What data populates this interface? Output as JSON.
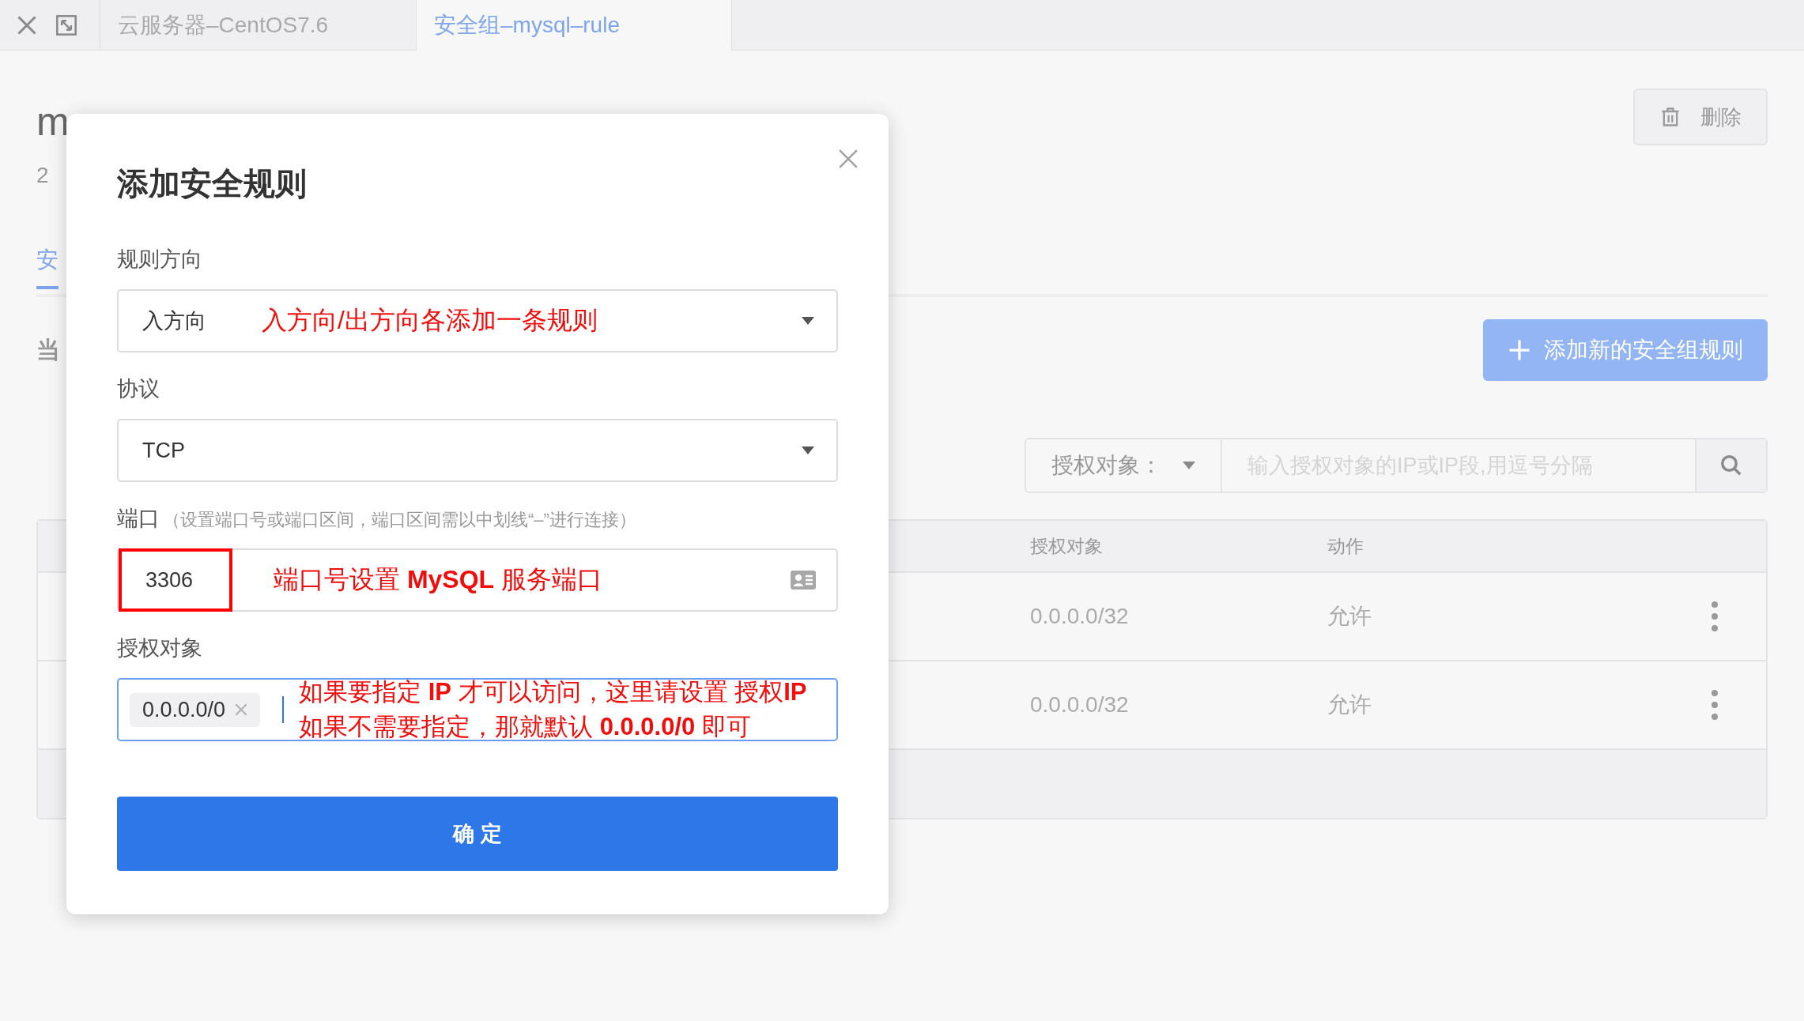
{
  "browser_tabs": [
    {
      "label": "云服务器–CentOS7.6",
      "selected": false
    },
    {
      "label": "安全组–mysql–rule",
      "selected": true
    }
  ],
  "background": {
    "title": "m",
    "subtitle": "2",
    "tab": "安",
    "note": "当",
    "delete_button": "删除",
    "add_button": "添加新的安全组规则",
    "filter": {
      "select": "授权对象：",
      "placeholder": "输入授权对象的IP或IP段,用逗号分隔"
    },
    "table": {
      "columns": [
        "授权对象",
        "动作"
      ],
      "rows": [
        {
          "cells": [
            "0.0.0.0/32",
            "允许"
          ]
        },
        {
          "cells": [
            "0.0.0.0/32",
            "允许"
          ]
        }
      ]
    }
  },
  "dialog": {
    "title": "添加安全规则",
    "fields": [
      {
        "kind": "select",
        "label": "规则方向",
        "value": "入方向",
        "annotation": [
          "入方向/出方向各添加一条规则"
        ]
      },
      {
        "kind": "select",
        "label": "协议",
        "value": "TCP"
      },
      {
        "kind": "number",
        "label": "端口",
        "hint": "（设置端口号或端口区间，端口区间需以中划线“–”进行连接）",
        "value": "3306",
        "boxed": true,
        "annotation": [
          "端口号设置 **MySQL** 服务端口"
        ]
      },
      {
        "kind": "tags",
        "label": "授权对象",
        "tags": [
          "0.0.0.0/0"
        ],
        "annotation": [
          "如果要指定 **IP** 才可以访问，这里请设置 授权**IP**",
          "如果不需要指定，那就默认 **0.0.0.0/0** 即可"
        ]
      }
    ],
    "confirm": "确 定"
  }
}
